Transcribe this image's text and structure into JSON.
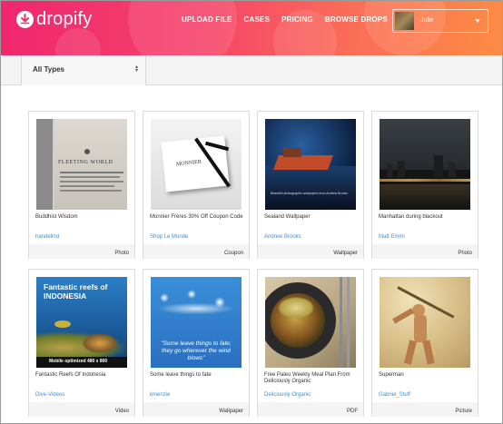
{
  "brand": {
    "name": "dropify"
  },
  "nav": [
    {
      "label": "UPLOAD FILE"
    },
    {
      "label": "CASES"
    },
    {
      "label": "PRICING"
    },
    {
      "label": "BROWSE DROPS"
    }
  ],
  "user": {
    "name": "Julie"
  },
  "filter": {
    "selected": "All Types"
  },
  "cards": [
    {
      "title": "Buddhist Wisdom",
      "author": "handelind",
      "type": "Photo",
      "image_text": "FLEETING WORLD"
    },
    {
      "title": "Monnier Frères 30% Off Coupon Code",
      "author": "Shop Le Monde",
      "type": "Coupon",
      "image_text": "MONNIER"
    },
    {
      "title": "Sealand Wallpaper",
      "author": "Andrew Brooks",
      "type": "Wallpaper",
      "image_text": "Beautiful photographic wallpapers from Andrew Brooks"
    },
    {
      "title": "Manhattan during blackout",
      "author": "Matt Emmi",
      "type": "Photo",
      "image_text": ""
    },
    {
      "title": "Fantastic Reefs Of Indonesia",
      "author": "Dive-Videos",
      "type": "Video",
      "image_text": "Fantastic reefs of INDONESIA",
      "image_caption": "Mobile optimized 480 x 800"
    },
    {
      "title": "Some leave things to fate",
      "author": "kmenzie",
      "type": "Wallpaper",
      "image_text": "\"Some leave things to fate; they go wherever the wind blows\""
    },
    {
      "title": "Free Paleo Weekly Meal Plan From Deliciously Organic",
      "author": "Deliciously Organic",
      "type": "PDF",
      "image_text": ""
    },
    {
      "title": "Superman",
      "author": "Gabriel_Stuff",
      "type": "Picture",
      "image_text": ""
    }
  ],
  "colors": {
    "header_start": "#f0266f",
    "header_end": "#fd8b45",
    "link": "#3b8fd6"
  }
}
